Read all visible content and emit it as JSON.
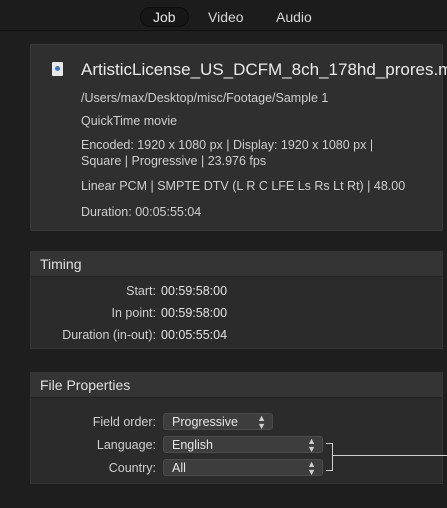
{
  "tabs": [
    {
      "label": "Job",
      "active": true
    },
    {
      "label": "Video",
      "active": false
    },
    {
      "label": "Audio",
      "active": false
    }
  ],
  "file": {
    "icon": "quicktime-file-icon",
    "name": "ArtisticLicense_US_DCFM_8ch_178hd_prores.m",
    "path": "/Users/max/Desktop/misc/Footage/Sample 1",
    "type": "QuickTime movie",
    "encoded_line1": "Encoded: 1920 x 1080 px | Display: 1920 x 1080 px |",
    "encoded_line2": "Square | Progressive | 23.976 fps",
    "audio": "Linear PCM | SMPTE DTV (L R C LFE Ls Rs Lt Rt) | 48.00",
    "duration": "Duration: 00:05:55:04"
  },
  "timing": {
    "title": "Timing",
    "rows": [
      {
        "label": "Start:",
        "value": "00:59:58:00"
      },
      {
        "label": "In point:",
        "value": "00:59:58:00"
      },
      {
        "label": "Duration (in-out):",
        "value": "00:05:55:04"
      }
    ]
  },
  "file_properties": {
    "title": "File Properties",
    "field_order": {
      "label": "Field order:",
      "value": "Progressive"
    },
    "language": {
      "label": "Language:",
      "value": "English"
    },
    "country": {
      "label": "Country:",
      "value": "All"
    }
  },
  "colors": {
    "background": "#1e1e1e",
    "panel": "#2b2b2b",
    "text": "#d9d9d9"
  }
}
